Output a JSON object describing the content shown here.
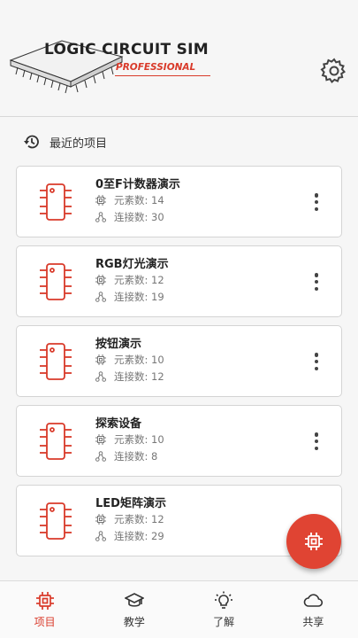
{
  "header": {
    "logo_title": "LOGIC CIRCUIT SIM",
    "logo_subtitle": "PROFESSIONAL"
  },
  "recent": {
    "title": "最近的项目",
    "items": [
      {
        "name": "0至F计数器演示",
        "elements": "元素数: 14",
        "connections": "连接数: 30"
      },
      {
        "name": "RGB灯光演示",
        "elements": "元素数: 12",
        "connections": "连接数: 19"
      },
      {
        "name": "按钮演示",
        "elements": "元素数: 10",
        "connections": "连接数: 12"
      },
      {
        "name": "探索设备",
        "elements": "元素数: 10",
        "connections": "连接数: 8"
      },
      {
        "name": "LED矩阵演示",
        "elements": "元素数: 12",
        "connections": "连接数: 29"
      }
    ]
  },
  "nav": {
    "items": [
      {
        "label": "项目",
        "icon": "chip-icon",
        "active": true
      },
      {
        "label": "教学",
        "icon": "graduation-cap-icon",
        "active": false
      },
      {
        "label": "了解",
        "icon": "lightbulb-icon",
        "active": false
      },
      {
        "label": "共享",
        "icon": "cloud-icon",
        "active": false
      }
    ]
  },
  "colors": {
    "accent": "#d93a2a",
    "fab": "#e04433",
    "background": "#f6f6f6"
  }
}
